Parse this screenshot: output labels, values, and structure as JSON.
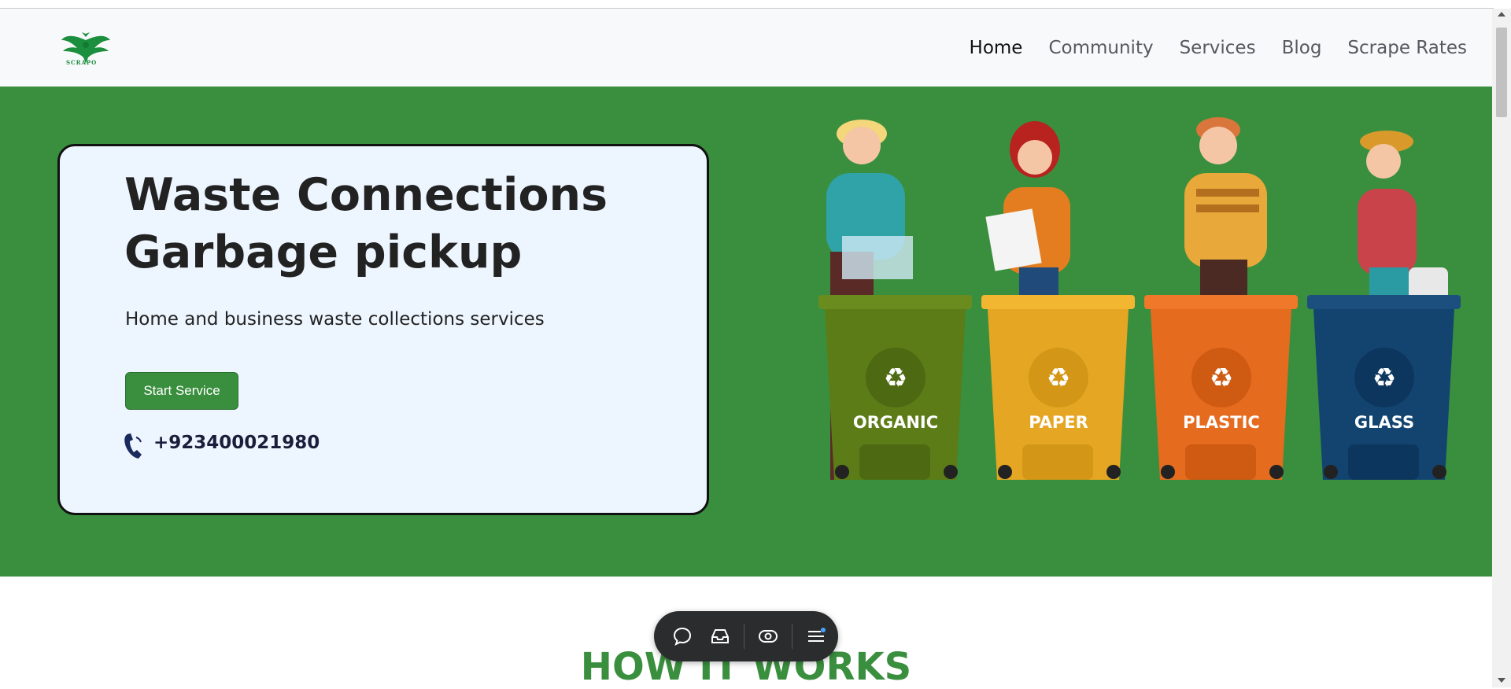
{
  "brand": {
    "logo_text": "SCRAPO"
  },
  "nav": {
    "items": [
      {
        "label": "Home",
        "active": true
      },
      {
        "label": "Community",
        "active": false
      },
      {
        "label": "Services",
        "active": false
      },
      {
        "label": "Blog",
        "active": false
      },
      {
        "label": "Scrape Rates",
        "active": false
      }
    ]
  },
  "hero": {
    "title_line1": "Waste Connections",
    "title_line2": "Garbage pickup",
    "subtitle": "Home and business waste collections services",
    "cta_label": "Start Service",
    "phone": "+923400021980",
    "bins": [
      "ORGANIC",
      "PAPER",
      "PLASTIC",
      "GLASS"
    ]
  },
  "section": {
    "heading": "HOW IT WORKS"
  },
  "toolbar": {
    "icons": [
      "chat-icon",
      "inbox-icon",
      "eye-icon",
      "menu-icon"
    ]
  },
  "colors": {
    "brand_green": "#3a8f3e",
    "card_bg": "#edf5ff"
  }
}
